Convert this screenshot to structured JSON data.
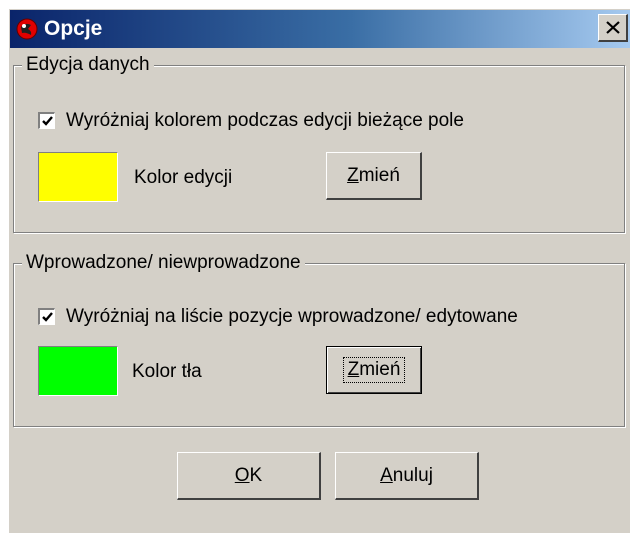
{
  "window": {
    "title": "Opcje",
    "close_icon": "close-icon"
  },
  "group_edit": {
    "title": "Edycja danych",
    "checkbox_label": "Wyróżniaj kolorem podczas edycji bieżące pole",
    "checked": true,
    "swatch_color": "#ffff00",
    "swatch_label": "Kolor edycji",
    "change_button": {
      "mnemonic": "Z",
      "rest": "mień"
    }
  },
  "group_entered": {
    "title": "Wprowadzone/ niewprowadzone",
    "checkbox_label": "Wyróżniaj na liście pozycje wprowadzone/ edytowane",
    "checked": true,
    "swatch_color": "#00ff00",
    "swatch_label": "Kolor tła",
    "change_button": {
      "mnemonic": "Z",
      "rest": "mień"
    }
  },
  "footer": {
    "ok_button": {
      "mnemonic": "O",
      "rest": "K"
    },
    "cancel_button": {
      "mnemonic": "A",
      "rest": "nuluj"
    }
  }
}
